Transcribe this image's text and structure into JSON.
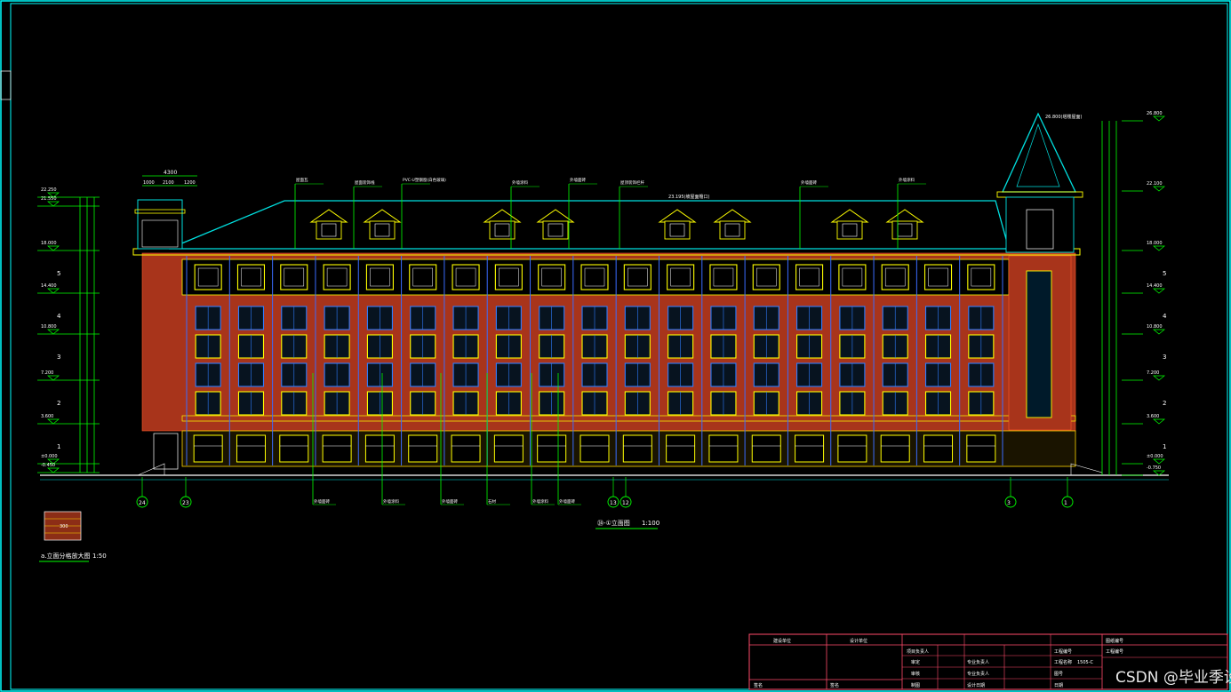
{
  "drawing": {
    "title": "㉔-①立面图",
    "scale": "1:100",
    "detail_title": "a.立面分格放大图",
    "detail_scale": "1:50",
    "detail_label": "300",
    "top_dim_total": "4300",
    "top_dims": [
      "1000",
      "2100",
      "1200"
    ],
    "roof_elevation": "23.195(坡屋面檐口)",
    "tower_elevation": "26.800(塔楼屋面)"
  },
  "left_levels": [
    {
      "elev": "22.250",
      "floor": ""
    },
    {
      "elev": "21.550",
      "floor": ""
    },
    {
      "elev": "18.000",
      "floor": "5"
    },
    {
      "elev": "14.400",
      "floor": "4"
    },
    {
      "elev": "10.800",
      "floor": "3"
    },
    {
      "elev": "7.200",
      "floor": "2"
    },
    {
      "elev": "3.600",
      "floor": "1"
    },
    {
      "elev": "±0.000",
      "floor": ""
    },
    {
      "elev": "-0.450",
      "floor": ""
    }
  ],
  "right_levels": [
    {
      "elev": "26.800",
      "floor": ""
    },
    {
      "elev": "22.100",
      "floor": ""
    },
    {
      "elev": "18.000",
      "floor": "5"
    },
    {
      "elev": "14.400",
      "floor": "4"
    },
    {
      "elev": "10.800",
      "floor": "3"
    },
    {
      "elev": "7.200",
      "floor": "2"
    },
    {
      "elev": "3.600",
      "floor": "1"
    },
    {
      "elev": "±0.000",
      "floor": ""
    },
    {
      "elev": "-0.750",
      "floor": ""
    }
  ],
  "axes": [
    "24",
    "23",
    "13",
    "12",
    "3",
    "1"
  ],
  "callouts_top": [
    "屋面瓦",
    "屋面装饰线",
    "PVC-U塑钢窗(白色玻璃)",
    "外墙涂料",
    "外墙面砖",
    "屋顶装饰栏杆",
    "23.195(坡屋面檐口)",
    "外墙面砖",
    "外墙涂料"
  ],
  "callouts_bottom": [
    "外墙面砖",
    "外墙涂料",
    "外墙面砖",
    "石材",
    "外墙涂料",
    "外墙面砖"
  ],
  "title_block": {
    "row1": [
      "建设单位",
      "设计单位",
      "",
      "",
      "",
      "图纸编号"
    ],
    "row2": [
      "",
      "",
      "项目负责人",
      "",
      "工程名称",
      "工程编号"
    ],
    "row3": [
      "",
      "",
      "审定",
      "",
      "专业负责人",
      "工程编号"
    ],
    "row4": [
      "",
      "",
      "审核",
      "",
      "专业负责人",
      "图号"
    ],
    "row5": [
      "签名",
      "签名",
      "制图",
      "",
      "设计日期",
      "日期"
    ],
    "code": "1505-C"
  },
  "watermark": "CSDN @毕业季设计",
  "colors": {
    "border": "#00ffff",
    "brick": "#b33a1e",
    "window": "#ffff00",
    "roof": "#00e0e0",
    "dim": "#00ff00",
    "leader": "#00ff00",
    "white": "#ffffff"
  }
}
